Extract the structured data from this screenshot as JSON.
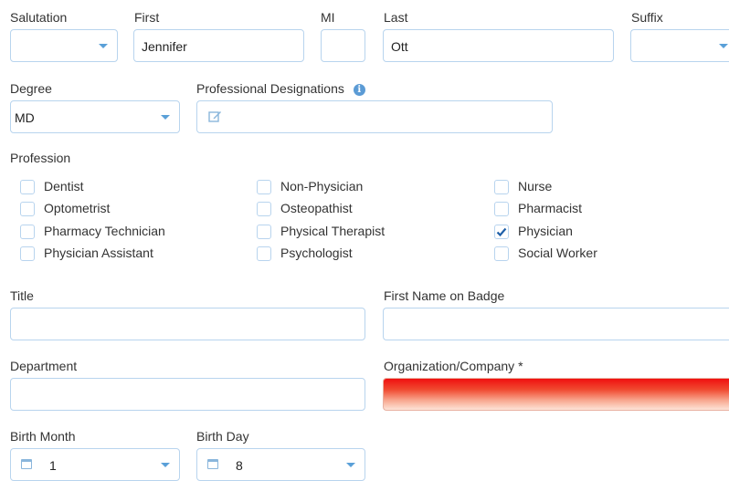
{
  "name": {
    "salutation_label": "Salutation",
    "salutation_value": "",
    "first_label": "First",
    "first_value": "Jennifer",
    "mi_label": "MI",
    "mi_value": "",
    "last_label": "Last",
    "last_value": "Ott",
    "suffix_label": "Suffix",
    "suffix_value": ""
  },
  "degree": {
    "label": "Degree",
    "value": "MD"
  },
  "designations": {
    "label": "Professional Designations",
    "info_icon": "info-icon",
    "edit_icon": "edit-icon"
  },
  "profession": {
    "label": "Profession",
    "options": [
      {
        "label": "Dentist",
        "checked": false
      },
      {
        "label": "Non-Physician",
        "checked": false
      },
      {
        "label": "Nurse",
        "checked": false
      },
      {
        "label": "Optometrist",
        "checked": false
      },
      {
        "label": "Osteopathist",
        "checked": false
      },
      {
        "label": "Pharmacist",
        "checked": false
      },
      {
        "label": "Pharmacy Technician",
        "checked": false
      },
      {
        "label": "Physical Therapist",
        "checked": false
      },
      {
        "label": "Physician",
        "checked": true
      },
      {
        "label": "Physician Assistant",
        "checked": false
      },
      {
        "label": "Psychologist",
        "checked": false
      },
      {
        "label": "Social Worker",
        "checked": false
      }
    ]
  },
  "title": {
    "label": "Title",
    "value": ""
  },
  "badge_name": {
    "label": "First Name on Badge",
    "value": ""
  },
  "department": {
    "label": "Department",
    "value": ""
  },
  "organization": {
    "label": "Organization/Company *",
    "value": "",
    "error_color": "#f01010"
  },
  "birth_month": {
    "label": "Birth Month",
    "value": "1"
  },
  "birth_day": {
    "label": "Birth Day",
    "value": "8"
  },
  "colors": {
    "border": "#b8d4ee",
    "accent": "#5aa0d8",
    "check": "#1e5fa8"
  }
}
